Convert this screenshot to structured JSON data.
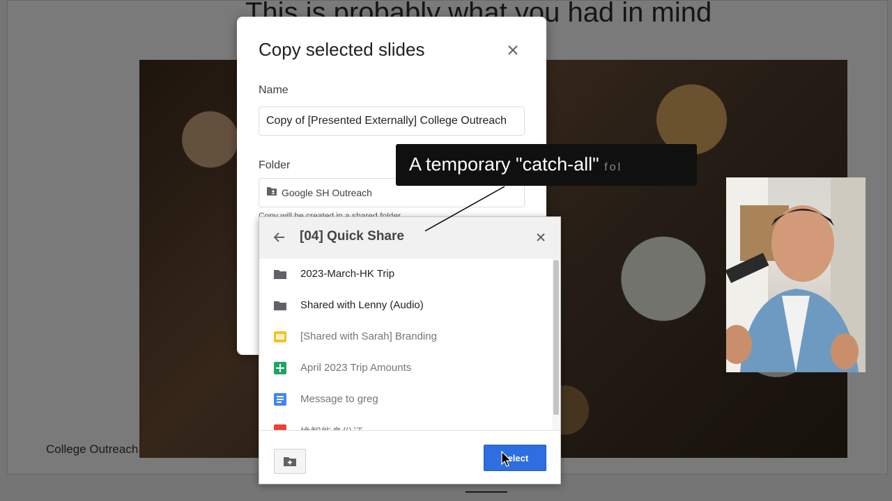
{
  "background": {
    "slide_title": "This is probably what you had in mind",
    "caption": "College Outreach"
  },
  "dialog": {
    "title": "Copy selected slides",
    "name_label": "Name",
    "name_value": "Copy of [Presented Externally] College Outreach",
    "folder_label": "Folder",
    "folder_value": "Google SH Outreach",
    "folder_hint": "Copy will be created in a shared folder"
  },
  "picker": {
    "title": "[04] Quick Share",
    "items": [
      {
        "label": "2023-March-HK Trip",
        "kind": "folder",
        "icon": "folder-icon"
      },
      {
        "label": "Shared with Lenny (Audio)",
        "kind": "folder",
        "icon": "folder-icon"
      },
      {
        "label": "[Shared with Sarah] Branding",
        "kind": "file",
        "icon": "slides-file-icon"
      },
      {
        "label": "April 2023 Trip Amounts",
        "kind": "file",
        "icon": "sheets-file-icon"
      },
      {
        "label": "Message to greg",
        "kind": "file",
        "icon": "docs-file-icon"
      },
      {
        "label": "換智能身份证",
        "kind": "file",
        "icon": "file-icon"
      }
    ],
    "select_label": "Select"
  },
  "overlay": {
    "caption_main": "A temporary \"catch-all\"",
    "caption_fade": "fol"
  },
  "colors": {
    "select_button": "#2f6ee0",
    "folder_icon": "#5f6368",
    "slides_icon": "#f6c026",
    "sheets_icon": "#1fa463",
    "docs_icon": "#4285f4",
    "pdf_icon": "#ea4335"
  }
}
